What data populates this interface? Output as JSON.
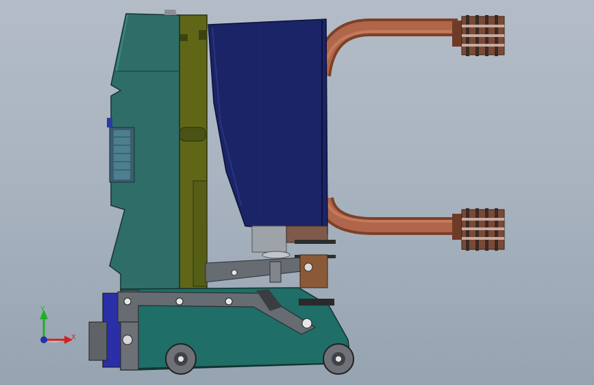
{
  "viewport": {
    "background_top": "#b3bcc7",
    "background_bottom": "#96a3b1"
  },
  "triad": {
    "y_label": "Y",
    "x_label": "X",
    "y_color": "#1fae2a",
    "x_color": "#d42020",
    "z_color": "#2233aa"
  },
  "model": {
    "front_housing_color": "#2f6e68",
    "middle_frame_color": "#5f6717",
    "insulating_cover_color": "#1a2466",
    "bus_arm_color": "#a35a3e",
    "contact_finger_color": "#7b4a36",
    "chassis_color": "#1f6e68",
    "linkage_color": "#676b72",
    "wheel_color": "#6e7177"
  }
}
